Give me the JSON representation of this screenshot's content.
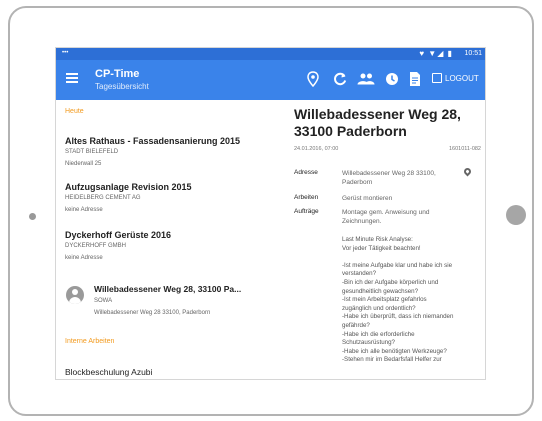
{
  "statusbar": {
    "dots": "•••",
    "icons": "♥ ▼◢ ▮",
    "time": "10:51"
  },
  "appbar": {
    "title": "CP-Time",
    "subtitle": "Tagesübersicht",
    "logout_label": "LOGOUT",
    "icons": [
      "location-icon",
      "refresh-icon",
      "team-icon",
      "clock-icon",
      "document-icon"
    ]
  },
  "left": {
    "section_today": "Heute",
    "jobs": [
      {
        "title": "Altes Rathaus - Fassadensanierung 2015",
        "company": "STADT BIELEFELD",
        "address": "Niederwall 25"
      },
      {
        "title": "Aufzugsanlage Revision 2015",
        "company": "HEIDELBERG CEMENT AG",
        "address": "keine Adresse"
      },
      {
        "title": "Dyckerhoff Gerüste 2016",
        "company": "DYCKERHOFF GMBH",
        "address": "keine Adresse"
      }
    ],
    "selected": {
      "title": "Willebadessener Weg 28, 33100 Pa...",
      "company": "SOWA",
      "address": "Willebadessener Weg 28 33100, Paderborn"
    },
    "section_internal": "Interne Arbeiten",
    "internal_item": "Blockbeschulung Azubi"
  },
  "detail": {
    "title": "Willebadessener Weg 28, 33100 Paderborn",
    "date": "24.01.2016, 07:00",
    "code": "1601011-082",
    "address_label": "Adresse",
    "address_value": "Willebadessener Weg 28 33100, Paderborn",
    "work_label": "Arbeiten",
    "work_value": "Gerüst montieren",
    "orders_label": "Aufträge",
    "orders_value": "Montage gem. Anweisung und Zeichnungen.",
    "notes": [
      "Last Minute Risk Analyse:",
      "Vor jeder Tätigkeit beachten!",
      "",
      "-Ist meine Aufgabe klar und habe ich sie",
      "verstanden?",
      "-Bin ich der Aufgabe körperlich und",
      "gesundheitlich gewachsen?",
      "-Ist mein Arbeitsplatz gefahrlos",
      "zugänglich und ordentlich?",
      "-Habe ich überprüft, dass ich niemanden",
      "gefährde?",
      "-Habe ich die erforderliche",
      "Schutzausrüstung?",
      "-Habe ich alle benötigten Werkzeuge?",
      "-Stehen mir im Bedarfsfall Helfer zur"
    ]
  }
}
